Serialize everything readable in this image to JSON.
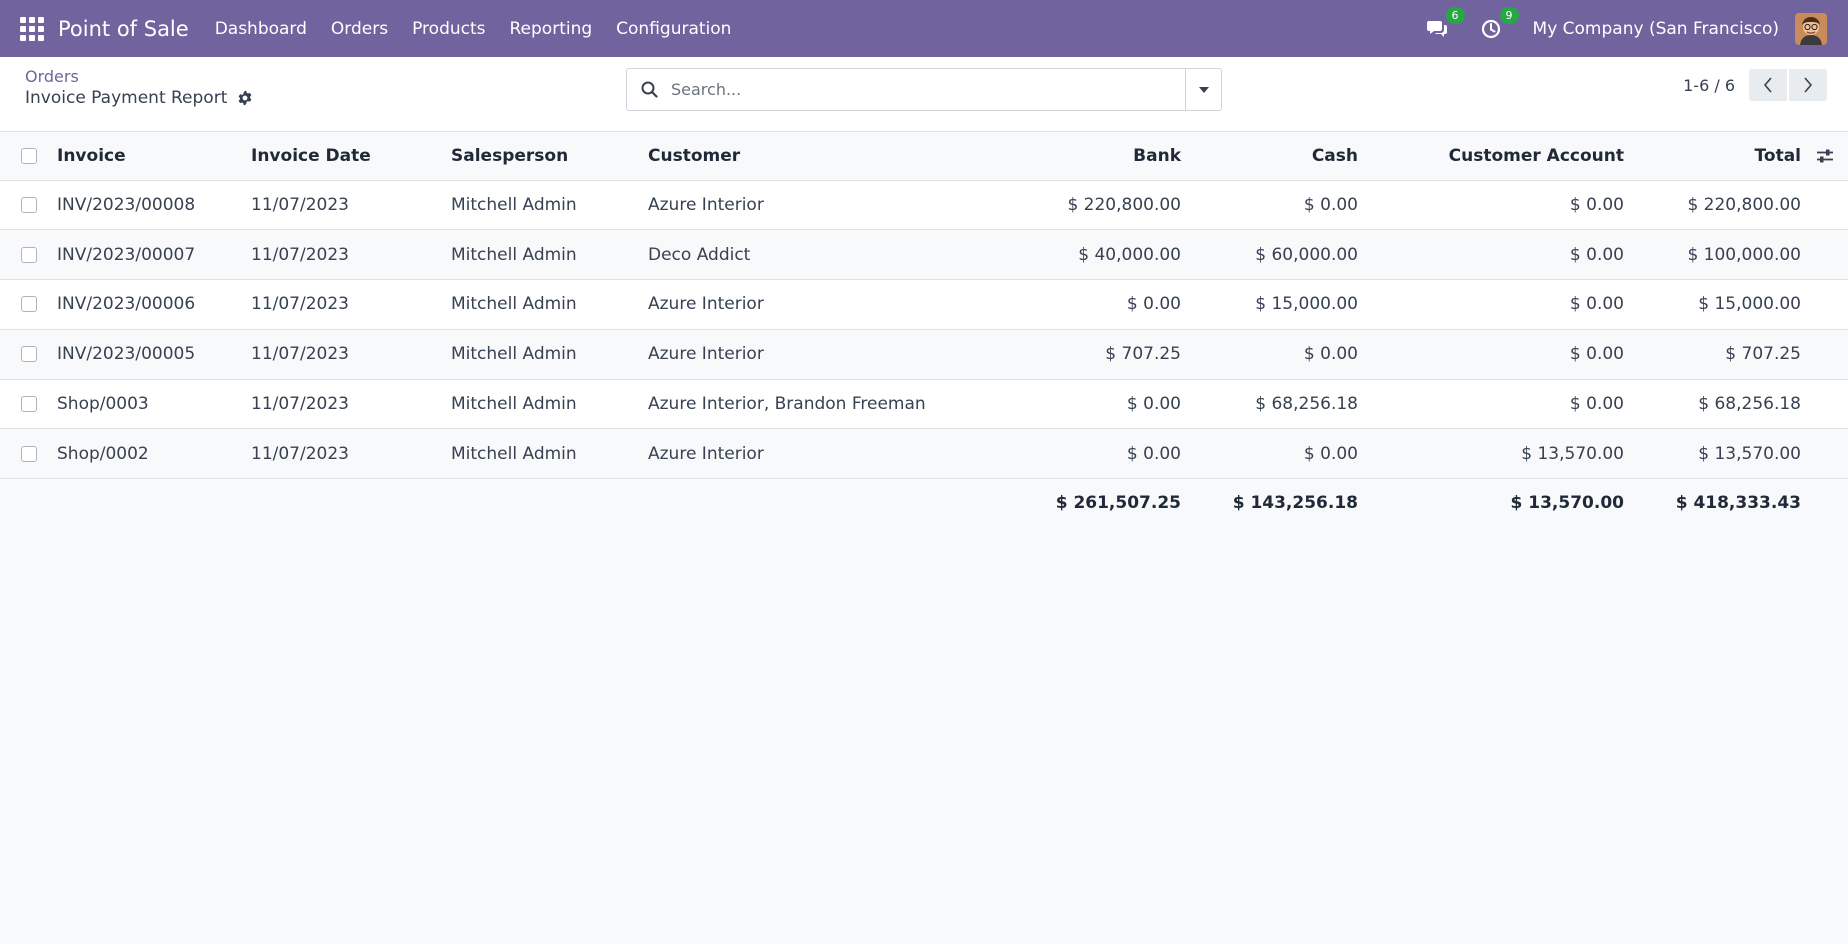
{
  "navbar": {
    "app_name": "Point of Sale",
    "menu": [
      "Dashboard",
      "Orders",
      "Products",
      "Reporting",
      "Configuration"
    ],
    "messages_count": "6",
    "activities_count": "9",
    "company": "My Company (San Francisco)",
    "color": "#71639e"
  },
  "control_panel": {
    "breadcrumb_parent": "Orders",
    "breadcrumb_current": "Invoice Payment Report",
    "search_placeholder": "Search...",
    "pager": "1-6 / 6"
  },
  "table": {
    "columns": [
      "Invoice",
      "Invoice Date",
      "Salesperson",
      "Customer",
      "Bank",
      "Cash",
      "Customer Account",
      "Total"
    ],
    "rows": [
      [
        "INV/2023/00008",
        "11/07/2023",
        "Mitchell Admin",
        "Azure Interior",
        "$ 220,800.00",
        "$ 0.00",
        "$ 0.00",
        "$ 220,800.00"
      ],
      [
        "INV/2023/00007",
        "11/07/2023",
        "Mitchell Admin",
        "Deco Addict",
        "$ 40,000.00",
        "$ 60,000.00",
        "$ 0.00",
        "$ 100,000.00"
      ],
      [
        "INV/2023/00006",
        "11/07/2023",
        "Mitchell Admin",
        "Azure Interior",
        "$ 0.00",
        "$ 15,000.00",
        "$ 0.00",
        "$ 15,000.00"
      ],
      [
        "INV/2023/00005",
        "11/07/2023",
        "Mitchell Admin",
        "Azure Interior",
        "$ 707.25",
        "$ 0.00",
        "$ 0.00",
        "$ 707.25"
      ],
      [
        "Shop/0003",
        "11/07/2023",
        "Mitchell Admin",
        "Azure Interior, Brandon Freeman",
        "$ 0.00",
        "$ 68,256.18",
        "$ 0.00",
        "$ 68,256.18"
      ],
      [
        "Shop/0002",
        "11/07/2023",
        "Mitchell Admin",
        "Azure Interior",
        "$ 0.00",
        "$ 0.00",
        "$ 13,570.00",
        "$ 13,570.00"
      ]
    ],
    "totals": {
      "bank": "$ 261,507.25",
      "cash": "$ 143,256.18",
      "customer_account": "$ 13,570.00",
      "total": "$ 418,333.43"
    }
  }
}
